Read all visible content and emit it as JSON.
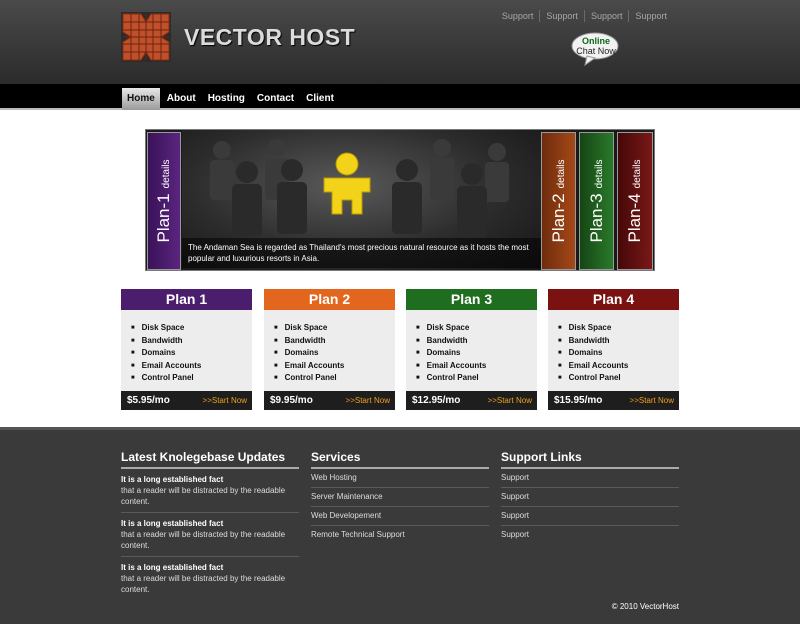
{
  "brand": {
    "name": "VECTOR HOST",
    "logo_colors": [
      "#c0502a",
      "#8a2e12"
    ]
  },
  "top_links": [
    "Support",
    "Support",
    "Support",
    "Support"
  ],
  "chat": {
    "line1": "Online",
    "line2": "Chat Now"
  },
  "nav": {
    "items": [
      {
        "label": "Home",
        "active": true
      },
      {
        "label": "About"
      },
      {
        "label": "Hosting"
      },
      {
        "label": "Contact"
      },
      {
        "label": "Client"
      }
    ]
  },
  "banner": {
    "caption": "The Andaman Sea is regarded as Thailand's most precious natural resource as it hosts the most popular and luxurious resorts in Asia.",
    "tabs": [
      {
        "title": "Plan-1",
        "sub": "details",
        "color": "#4a1a6a"
      },
      {
        "title": "Plan-2",
        "sub": "details",
        "color": "#8a3a12"
      },
      {
        "title": "Plan-3",
        "sub": "details",
        "color": "#1f5a1f"
      },
      {
        "title": "Plan-4",
        "sub": "details",
        "color": "#5a1010"
      }
    ]
  },
  "plans": [
    {
      "name": "Plan 1",
      "color": "#4b1d6d",
      "features": [
        "Disk Space",
        "Bandwidth",
        "Domains",
        "Email Accounts",
        "Control Panel"
      ],
      "price": "$5.95/mo",
      "cta": ">>Start Now"
    },
    {
      "name": "Plan 2",
      "color": "#e2661e",
      "features": [
        "Disk Space",
        "Bandwidth",
        "Domains",
        "Email Accounts",
        "Control Panel"
      ],
      "price": "$9.95/mo",
      "cta": ">>Start Now"
    },
    {
      "name": "Plan 3",
      "color": "#1f6e1f",
      "features": [
        "Disk Space",
        "Bandwidth",
        "Domains",
        "Email Accounts",
        "Control Panel"
      ],
      "price": "$12.95/mo",
      "cta": ">>Start Now"
    },
    {
      "name": "Plan 4",
      "color": "#7a1212",
      "features": [
        "Disk Space",
        "Bandwidth",
        "Domains",
        "Email Accounts",
        "Control Panel"
      ],
      "price": "$15.95/mo",
      "cta": ">>Start Now"
    }
  ],
  "footer": {
    "kb": {
      "title": "Latest Knolegebase Updates",
      "items": [
        {
          "title": "It is a long established fact",
          "text": "that a reader will be distracted by the readable content."
        },
        {
          "title": "It is a long established fact",
          "text": "that a reader will be distracted by the readable content."
        },
        {
          "title": "It is a long established fact",
          "text": "that a reader will be distracted by the readable content."
        }
      ]
    },
    "services": {
      "title": "Services",
      "items": [
        "Web Hosting",
        "Server Maintenance",
        "Web Developement",
        "Remote Technical Support"
      ]
    },
    "support": {
      "title": "Support Links",
      "items": [
        "Support",
        "Support",
        "Support",
        "Support"
      ]
    },
    "copyright": "© 2010 VectorHost"
  }
}
